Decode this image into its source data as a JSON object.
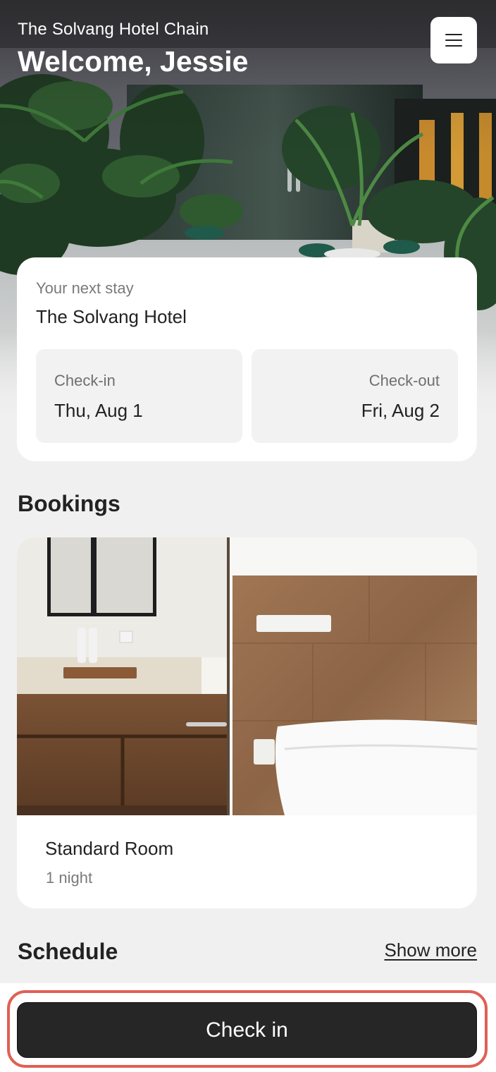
{
  "header": {
    "brand": "The Solvang Hotel Chain",
    "welcome": "Welcome, Jessie",
    "menu_icon": "hamburger-menu-icon"
  },
  "next_stay": {
    "label": "Your next stay",
    "hotel": "The Solvang Hotel",
    "check_in_label": "Check-in",
    "check_in_date": "Thu, Aug 1",
    "check_out_label": "Check-out",
    "check_out_date": "Fri, Aug 2"
  },
  "bookings": {
    "title": "Bookings",
    "items": [
      {
        "room": "Standard Room",
        "nights": "1 night"
      }
    ]
  },
  "schedule": {
    "title": "Schedule",
    "show_more": "Show more"
  },
  "actions": {
    "check_in": "Check in"
  },
  "colors": {
    "primary_button": "#262626",
    "highlight_outline": "#e06055",
    "background": "#f0f0f0"
  }
}
